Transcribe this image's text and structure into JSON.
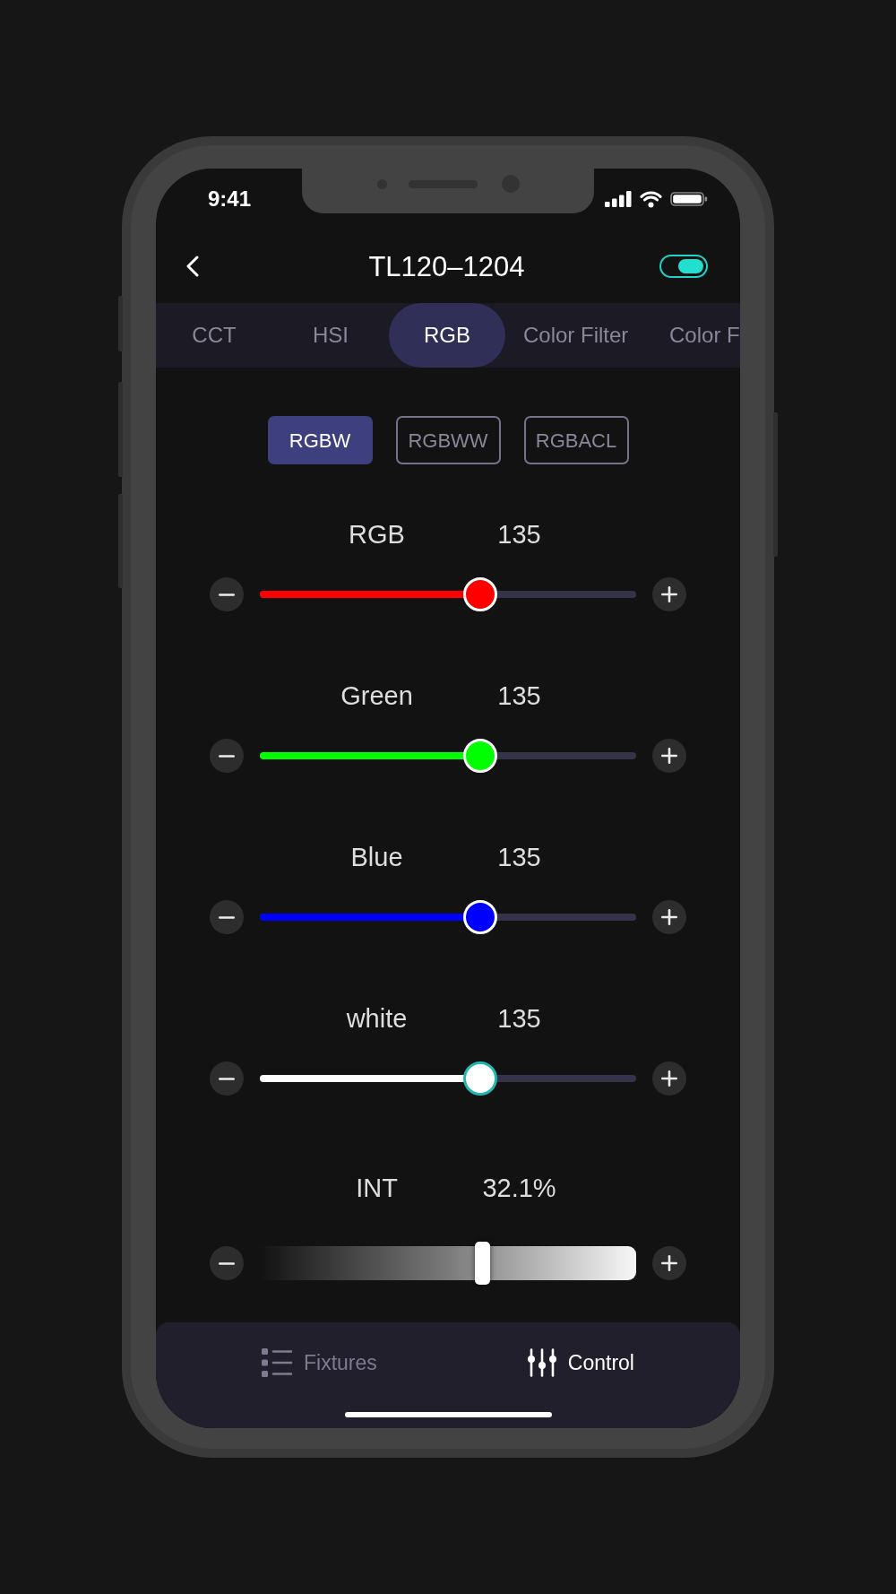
{
  "status_bar": {
    "time": "9:41"
  },
  "header": {
    "title": "TL120–1204",
    "toggle": {
      "on": true
    }
  },
  "tabs": [
    {
      "label": "CCT",
      "selected": false
    },
    {
      "label": "HSI",
      "selected": false
    },
    {
      "label": "RGB",
      "selected": true
    },
    {
      "label": "Color Filter",
      "selected": false
    },
    {
      "label": "Color F",
      "selected": false
    }
  ],
  "modes": [
    {
      "label": "RGBW",
      "selected": true
    },
    {
      "label": "RGBWW",
      "selected": false
    },
    {
      "label": "RGBACL",
      "selected": false
    }
  ],
  "sliders": [
    {
      "kind": "color",
      "name": "RGB",
      "value": "135",
      "level": 0.585,
      "color": "#ff0000"
    },
    {
      "kind": "color",
      "name": "Green",
      "value": "135",
      "level": 0.585,
      "color": "#00ff00"
    },
    {
      "kind": "color",
      "name": "Blue",
      "value": "135",
      "level": 0.585,
      "color": "#0000ff"
    },
    {
      "kind": "color",
      "name": "white",
      "value": "135",
      "level": 0.585,
      "color": "#ffffff"
    },
    {
      "kind": "gradient",
      "name": "INT",
      "value": "32.1%",
      "level": 0.59
    }
  ],
  "bottom_nav": [
    {
      "label": "Fixtures",
      "selected": false
    },
    {
      "label": "Control",
      "selected": true
    }
  ]
}
